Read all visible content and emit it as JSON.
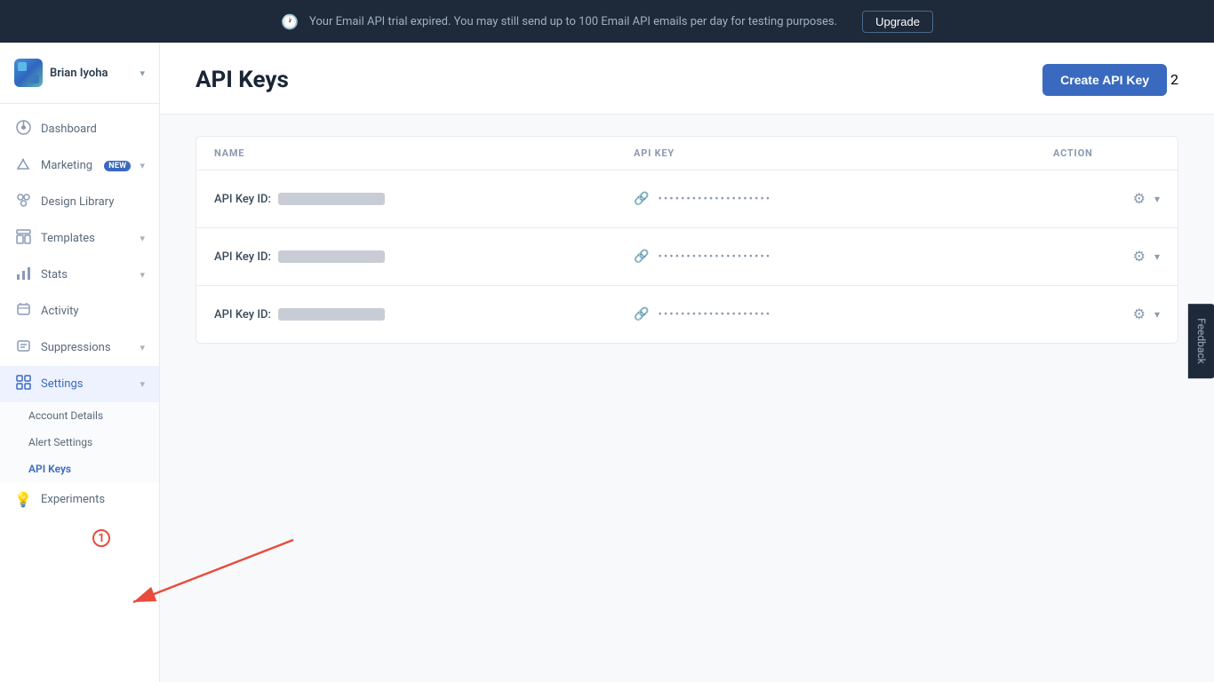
{
  "banner": {
    "icon": "🕐",
    "message": "Your Email API trial expired. You may still send up to 100 Email API emails per day for testing purposes.",
    "upgrade_label": "Upgrade"
  },
  "sidebar": {
    "user_name": "Brian Iyoha",
    "items": [
      {
        "id": "dashboard",
        "label": "Dashboard",
        "icon": "dashboard",
        "badge": null,
        "has_chevron": false
      },
      {
        "id": "marketing",
        "label": "Marketing",
        "icon": "marketing",
        "badge": "NEW",
        "has_chevron": true
      },
      {
        "id": "design-library",
        "label": "Design Library",
        "icon": "design",
        "badge": null,
        "has_chevron": false
      },
      {
        "id": "templates",
        "label": "Templates",
        "icon": "templates",
        "badge": null,
        "has_chevron": true
      },
      {
        "id": "stats",
        "label": "Stats",
        "icon": "stats",
        "badge": null,
        "has_chevron": true
      },
      {
        "id": "activity",
        "label": "Activity",
        "icon": "activity",
        "badge": null,
        "has_chevron": false
      },
      {
        "id": "suppressions",
        "label": "Suppressions",
        "icon": "suppressions",
        "badge": null,
        "has_chevron": true
      },
      {
        "id": "settings",
        "label": "Settings",
        "icon": "settings",
        "badge": null,
        "has_chevron": true,
        "active": true
      }
    ],
    "settings_sub": [
      {
        "id": "account-details",
        "label": "Account Details"
      },
      {
        "id": "alert-settings",
        "label": "Alert Settings"
      },
      {
        "id": "api-keys",
        "label": "API Keys",
        "active": true
      }
    ],
    "experiments": {
      "label": "Experiments",
      "icon": "bulb"
    }
  },
  "page": {
    "title": "API Keys",
    "create_button": "Create API Key",
    "badge_number": "2"
  },
  "table": {
    "headers": {
      "name": "NAME",
      "api_key": "API KEY",
      "action": "ACTION"
    },
    "rows": [
      {
        "id": "row-1",
        "name_label": "API Key ID:",
        "dots": "••••••••••••••••••••"
      },
      {
        "id": "row-2",
        "name_label": "API Key ID:",
        "dots": "••••••••••••••••••••"
      },
      {
        "id": "row-3",
        "name_label": "API Key ID:",
        "dots": "••••••••••••••••••••"
      }
    ]
  },
  "feedback": {
    "label": "Feedback"
  },
  "annotations": {
    "badge_1": "1",
    "badge_2": "2"
  }
}
